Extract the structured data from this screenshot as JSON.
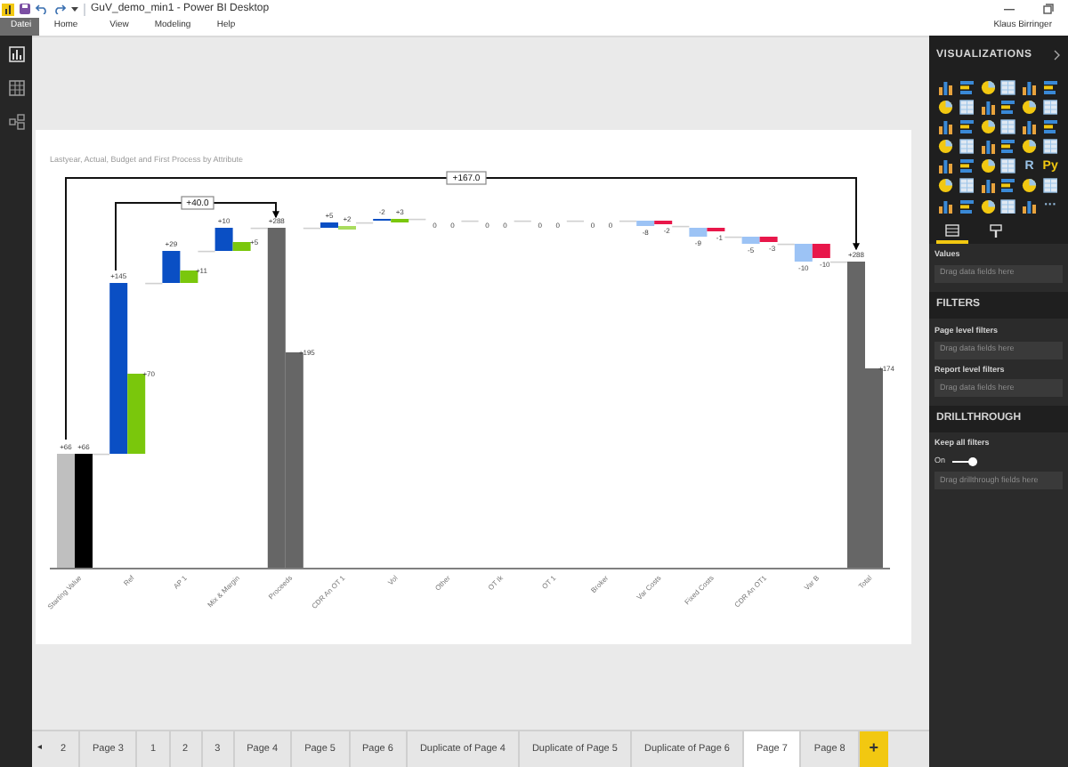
{
  "window": {
    "title": "GuV_demo_min1 - Power BI Desktop",
    "user": "Klaus Birringer"
  },
  "menu": [
    {
      "label": "Datei",
      "selected": true
    },
    {
      "label": "Home",
      "selected": false
    },
    {
      "label": "View",
      "selected": false
    },
    {
      "label": "Modeling",
      "selected": false
    },
    {
      "label": "Help",
      "selected": false
    }
  ],
  "chart": {
    "title": "Lastyear, Actual, Budget and First Process by Attribute",
    "categories": [
      {
        "label": "Starting Value",
        "values": [
          "+66",
          "+66"
        ]
      },
      {
        "label": "Ref",
        "values": [
          "+145",
          "+70"
        ]
      },
      {
        "label": "AP 1",
        "values": [
          "+29",
          "+11"
        ]
      },
      {
        "label": "Mix & Margin",
        "values": [
          "+10",
          "+5"
        ]
      },
      {
        "label": "Proceeds",
        "values": [
          "+288",
          "+195"
        ]
      },
      {
        "label": "CDR An OT 1",
        "values": [
          "+5",
          "+2"
        ]
      },
      {
        "label": "Vol",
        "values": [
          "-2",
          "+3"
        ]
      },
      {
        "label": "Other",
        "values": [
          "0",
          "0"
        ]
      },
      {
        "label": "OT Ik",
        "values": [
          "0",
          "0"
        ]
      },
      {
        "label": "OT 1",
        "values": [
          "0",
          "0"
        ]
      },
      {
        "label": "Broker",
        "values": [
          "0",
          "0"
        ]
      },
      {
        "label": "Var Costs",
        "values": [
          "-8",
          "-2"
        ]
      },
      {
        "label": "Fixed Costs",
        "values": [
          "-9",
          "-1"
        ]
      },
      {
        "label": "CDR An OT1",
        "values": [
          "-5",
          "-3"
        ]
      },
      {
        "label": "Var B",
        "values": [
          "-10",
          "-10"
        ]
      },
      {
        "label": "Total",
        "values": [
          "+288",
          "+174"
        ]
      }
    ],
    "arrows": [
      {
        "label": "+167.0"
      },
      {
        "label": "+40.0"
      }
    ]
  },
  "visualizations": {
    "title": "VISUALIZATIONS",
    "glyphs": [
      {
        "text": "R"
      },
      {
        "text": "Py"
      },
      {
        "text": "···"
      }
    ],
    "tabs": [
      {
        "kind": "fields",
        "selected": true
      },
      {
        "kind": "format",
        "selected": false
      }
    ],
    "values_label": "Values",
    "values_placeholder": "Drag data fields here"
  },
  "filters": {
    "title": "FILTERS",
    "groups": [
      {
        "label": "Page level filters",
        "placeholder": "Drag data fields here"
      },
      {
        "label": "Report level filters",
        "placeholder": "Drag data fields here"
      }
    ]
  },
  "drillthrough": {
    "title": "DRILLTHROUGH",
    "keep_label": "Keep all filters",
    "toggle": {
      "on": true,
      "text": "On"
    },
    "placeholder": "Drag drillthrough fields here"
  },
  "page_tabs": [
    {
      "label": "◂",
      "selected": false
    },
    {
      "label": "2",
      "selected": false
    },
    {
      "label": "Page 3",
      "selected": false
    },
    {
      "label": "1",
      "selected": false
    },
    {
      "label": "2",
      "selected": false
    },
    {
      "label": "3",
      "selected": false
    },
    {
      "label": "Page 4",
      "selected": false
    },
    {
      "label": "Page 5",
      "selected": false
    },
    {
      "label": "Page 6",
      "selected": false
    },
    {
      "label": "Duplicate of Page 4",
      "selected": false
    },
    {
      "label": "Duplicate of Page 5",
      "selected": false
    },
    {
      "label": "Duplicate of Page 6",
      "selected": false
    },
    {
      "label": "Page 7",
      "selected": true
    },
    {
      "label": "Page 8",
      "selected": false
    },
    {
      "label": "+",
      "selected": false
    }
  ]
}
